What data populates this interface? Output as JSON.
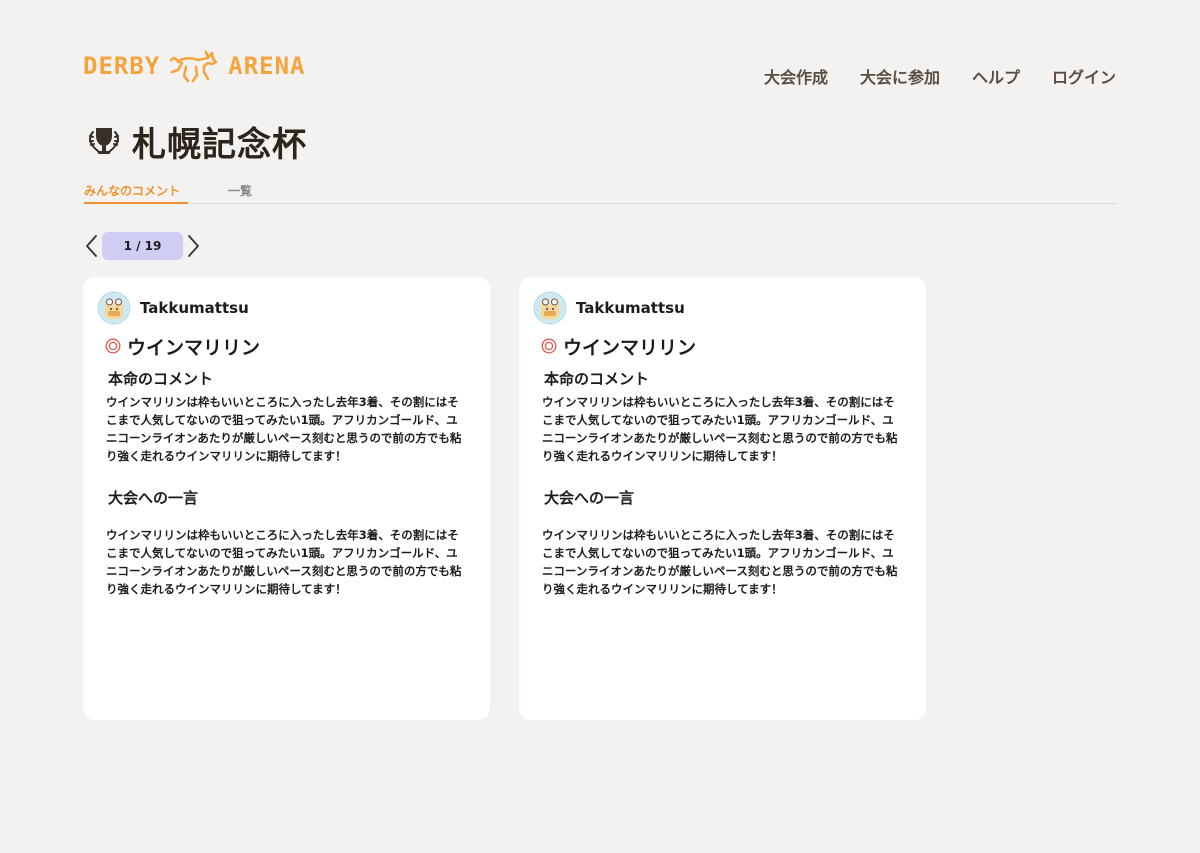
{
  "header": {
    "logo_left": "DERBY",
    "logo_right": "ARENA",
    "nav": [
      "大会作成",
      "大会に参加",
      "ヘルプ",
      "ログイン"
    ]
  },
  "page": {
    "title": "札幌記念杯",
    "tabs": [
      "みんなのコメント",
      "一覧"
    ],
    "active_tab": "みんなのコメント"
  },
  "pager": {
    "label": "1 / 19"
  },
  "cards": [
    {
      "user": "Takkumattsu",
      "mark": "◎",
      "horse": "ウインマリリン",
      "section1_title": "本命のコメント",
      "section1_body": "ウインマリリンは枠もいいところに入ったし去年3着、その割にはそこまで人気してないので狙ってみたい1頭。アフリカンゴールド、ユニコーンライオンあたりが厳しいペース刻むと思うので前の方でも粘り強く走れるウインマリリンに期待してます！",
      "section2_title": "大会への一言",
      "section2_body": "ウインマリリンは枠もいいところに入ったし去年3着、その割にはそこまで人気してないので狙ってみたい1頭。アフリカンゴールド、ユニコーンライオンあたりが厳しいペース刻むと思うので前の方でも粘り強く走れるウインマリリンに期待してます！"
    },
    {
      "user": "Takkumattsu",
      "mark": "◎",
      "horse": "ウインマリリン",
      "section1_title": "本命のコメント",
      "section1_body": "ウインマリリンは枠もいいところに入ったし去年3着、その割にはそこまで人気してないので狙ってみたい1頭。アフリカンゴールド、ユニコーンライオンあたりが厳しいペース刻むと思うので前の方でも粘り強く走れるウインマリリンに期待してます！",
      "section2_title": "大会への一言",
      "section2_body": "ウインマリリンは枠もいいところに入ったし去年3着、その割にはそこまで人気してないので狙ってみたい1頭。アフリカンゴールド、ユニコーンライオンあたりが厳しいペース刻むと思うので前の方でも粘り強く走れるウインマリリンに期待してます！"
    }
  ],
  "colors": {
    "background": "#f3f2f1",
    "accent_orange": "#f0922b",
    "logo": "#f4a43d",
    "pager_badge": "#cfcdf4",
    "mark_red": "#e05a4f"
  },
  "icons": {
    "logo": "horse-logo-icon",
    "title": "trophy-icon",
    "pager_prev": "chevron-left-icon",
    "pager_next": "chevron-right-icon",
    "avatar": "user-avatar-icon",
    "mark": "double-circle-icon"
  }
}
